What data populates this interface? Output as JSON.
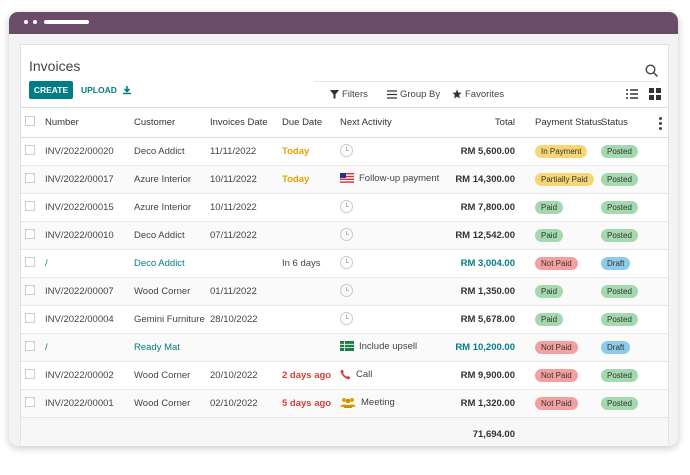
{
  "page": {
    "title": "Invoices",
    "create_label": "CREATE",
    "upload_label": "UPLOAD",
    "filters_label": "Filters",
    "groupby_label": "Group By",
    "favorites_label": "Favorites"
  },
  "columns": [
    "Number",
    "Customer",
    "Invoices Date",
    "Due Date",
    "Next Activity",
    "Total",
    "Payment Status",
    "Status"
  ],
  "rows": [
    {
      "number": "INV/2022/00020",
      "customer": "Deco Addict",
      "date": "11/11/2022",
      "due": "Today",
      "due_style": "today",
      "activity": "",
      "activity_icon": "clock-icon",
      "total": "RM 5,600.00",
      "payment": "In Payment",
      "payment_color": "yellow",
      "status": "Posted",
      "status_color": "green",
      "draft": false
    },
    {
      "number": "INV/2022/00017",
      "customer": "Azure Interior",
      "date": "10/11/2022",
      "due": "Today",
      "due_style": "today",
      "activity": "Follow-up payment",
      "activity_icon": "flag-icon",
      "total": "RM 14,300.00",
      "payment": "Partially Paid",
      "payment_color": "yellow",
      "status": "Posted",
      "status_color": "green",
      "draft": false
    },
    {
      "number": "INV/2022/00015",
      "customer": "Azure Interior",
      "date": "10/11/2022",
      "due": "",
      "due_style": "",
      "activity": "",
      "activity_icon": "clock-icon",
      "total": "RM 7,800.00",
      "payment": "Paid",
      "payment_color": "green",
      "status": "Posted",
      "status_color": "green",
      "draft": false
    },
    {
      "number": "INV/2022/00010",
      "customer": "Deco Addict",
      "date": "07/11/2022",
      "due": "",
      "due_style": "",
      "activity": "",
      "activity_icon": "clock-icon",
      "total": "RM 12,542.00",
      "payment": "Paid",
      "payment_color": "green",
      "status": "Posted",
      "status_color": "green",
      "draft": false
    },
    {
      "number": "/",
      "customer": "Deco Addict",
      "date": "",
      "due": "In 6 days",
      "due_style": "",
      "activity": "",
      "activity_icon": "clock-icon",
      "total": "RM 3,004.00",
      "payment": "Not Paid",
      "payment_color": "red",
      "status": "Draft",
      "status_color": "blue",
      "draft": true
    },
    {
      "number": "INV/2022/00007",
      "customer": "Wood Corner",
      "date": "01/11/2022",
      "due": "",
      "due_style": "",
      "activity": "",
      "activity_icon": "clock-icon",
      "total": "RM 1,350.00",
      "payment": "Paid",
      "payment_color": "green",
      "status": "Posted",
      "status_color": "green",
      "draft": false
    },
    {
      "number": "INV/2022/00004",
      "customer": "Gemini Furniture",
      "date": "28/10/2022",
      "due": "",
      "due_style": "",
      "activity": "",
      "activity_icon": "clock-icon",
      "total": "RM 5,678.00",
      "payment": "Paid",
      "payment_color": "green",
      "status": "Posted",
      "status_color": "green",
      "draft": false
    },
    {
      "number": "/",
      "customer": "Ready Mat",
      "date": "",
      "due": "",
      "due_style": "",
      "activity": "Include upsell",
      "activity_icon": "spreadsheet-icon",
      "total": "RM 10,200.00",
      "payment": "Not Paid",
      "payment_color": "red",
      "status": "Draft",
      "status_color": "blue",
      "draft": true
    },
    {
      "number": "INV/2022/00002",
      "customer": "Wood Corner",
      "date": "20/10/2022",
      "due": "2 days ago",
      "due_style": "late",
      "activity": "Call",
      "activity_icon": "phone-icon",
      "total": "RM 9,900.00",
      "payment": "Not Paid",
      "payment_color": "red",
      "status": "Posted",
      "status_color": "green",
      "draft": false
    },
    {
      "number": "INV/2022/00001",
      "customer": "Wood Corner",
      "date": "02/10/2022",
      "due": "5 days ago",
      "due_style": "late",
      "activity": "Meeting",
      "activity_icon": "people-icon",
      "total": "RM 1,320.00",
      "payment": "Not Paid",
      "payment_color": "red",
      "status": "Posted",
      "status_color": "green",
      "draft": false
    }
  ],
  "grand_total": "71,694.00",
  "colors": {
    "accent": "#017e84",
    "titlebar": "#6c4d69",
    "today": "#e5a100",
    "late": "#d23f3a"
  }
}
